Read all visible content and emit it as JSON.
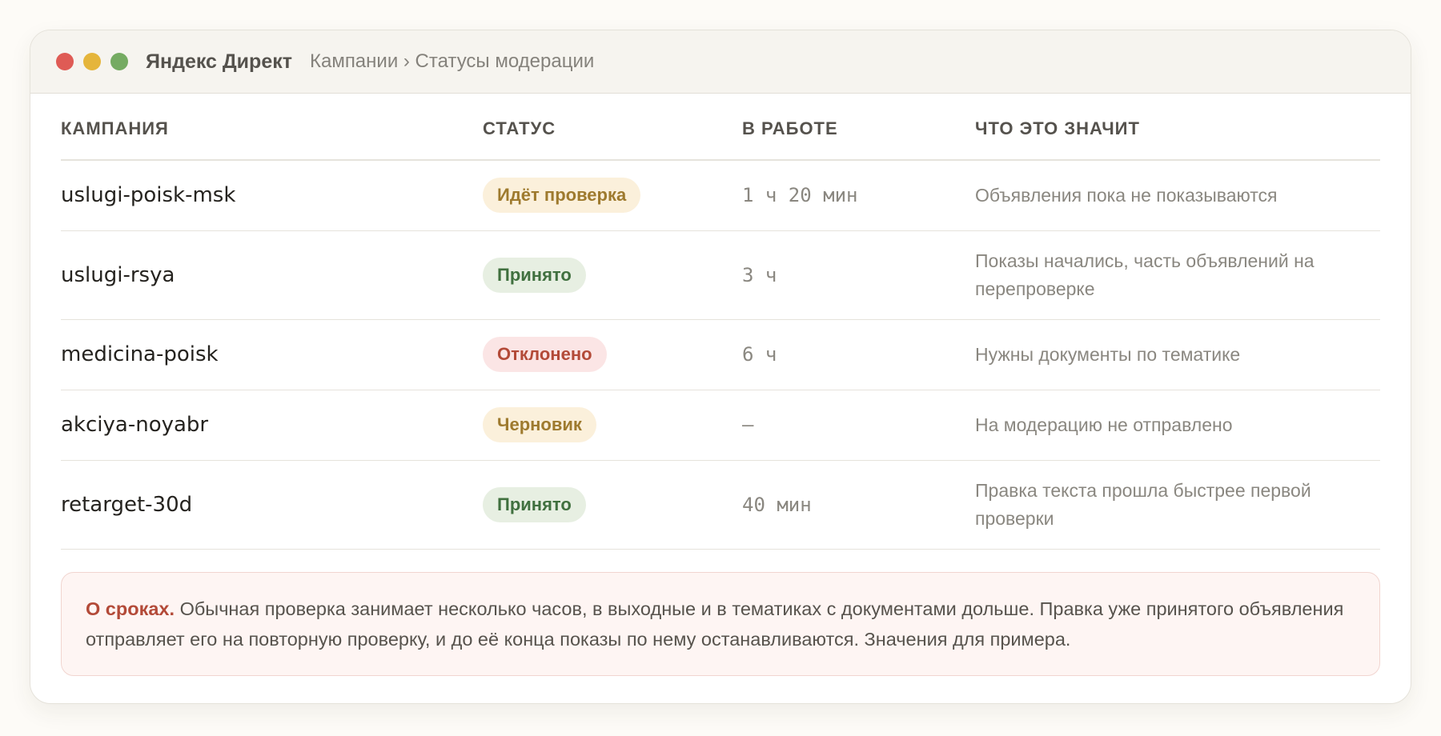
{
  "window": {
    "app_title": "Яндекс Директ",
    "breadcrumb": "Кампании › Статусы модерации"
  },
  "table": {
    "headers": [
      "КАМПАНИЯ",
      "СТАТУС",
      "В РАБОТЕ",
      "ЧТО ЭТО ЗНАЧИТ"
    ],
    "rows": [
      {
        "campaign": "uslugi-poisk-msk",
        "status": "Идёт проверка",
        "status_tone": "yellow",
        "time": "1 ч 20 мин",
        "meaning": "Объявления пока не показываются"
      },
      {
        "campaign": "uslugi-rsya",
        "status": "Принято",
        "status_tone": "green",
        "time": "3 ч",
        "meaning": "Показы начались, часть объявлений на перепроверке"
      },
      {
        "campaign": "medicina-poisk",
        "status": "Отклонено",
        "status_tone": "red",
        "time": "6 ч",
        "meaning": "Нужны документы по тематике"
      },
      {
        "campaign": "akciya-noyabr",
        "status": "Черновик",
        "status_tone": "yellow",
        "time": "—",
        "meaning": "На модерацию не отправлено"
      },
      {
        "campaign": "retarget-30d",
        "status": "Принято",
        "status_tone": "green",
        "time": "40 мин",
        "meaning": "Правка текста прошла быстрее первой проверки"
      }
    ]
  },
  "note": {
    "title": "О сроках.",
    "text": "Обычная проверка занимает несколько часов, в выходные и в тематиках с документами дольше. Правка уже принятого объявления отправляет его на повторную проверку, и до её конца показы по нему останавливаются. Значения для примера."
  },
  "colors": {
    "close": "#df5b55",
    "minimize": "#e5b53b",
    "maximize": "#75ab62",
    "status_yellow_text": "#9e7a2e",
    "status_green_text": "#40703f",
    "status_red_text": "#b34a38",
    "note_accent": "#b34a38"
  }
}
